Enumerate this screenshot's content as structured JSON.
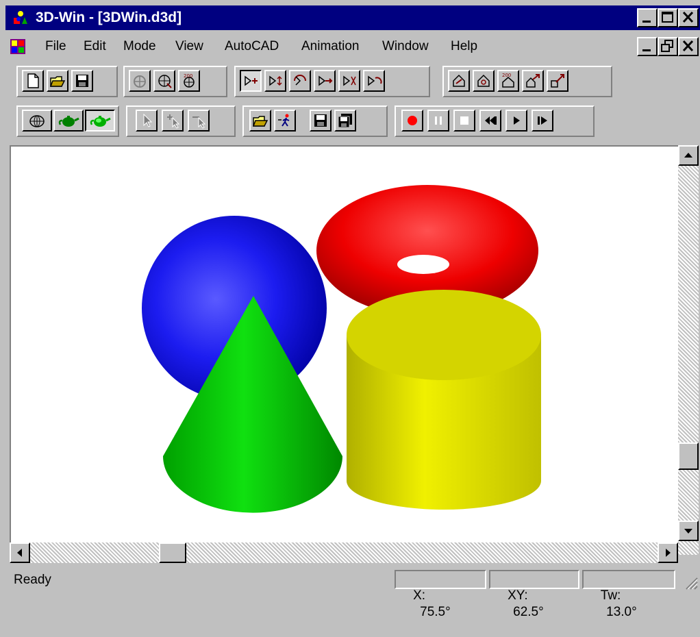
{
  "window": {
    "title": "3D-Win - [3DWin.d3d]"
  },
  "menu": {
    "items": [
      {
        "label": "File"
      },
      {
        "label": "Edit"
      },
      {
        "label": "Mode"
      },
      {
        "label": "View"
      },
      {
        "label": "AutoCAD"
      },
      {
        "label": "Animation"
      },
      {
        "label": "Window"
      },
      {
        "label": "Help"
      }
    ]
  },
  "scene": {
    "objects": [
      {
        "name": "sphere",
        "color": "#1a1aff"
      },
      {
        "name": "torus",
        "color": "#ff1a1a"
      },
      {
        "name": "cone",
        "color": "#1ac81a"
      },
      {
        "name": "cylinder",
        "color": "#e6e61a"
      }
    ]
  },
  "status": {
    "ready": "Ready",
    "x_label": "X:",
    "x_value": "75.5°",
    "xy_label": "XY:",
    "xy_value": "62.5°",
    "tw_label": "Tw:",
    "tw_value": "13.0°"
  },
  "colors": {
    "titlebar": "#000080",
    "face": "#c0c0c0",
    "record": "#ff0000"
  }
}
